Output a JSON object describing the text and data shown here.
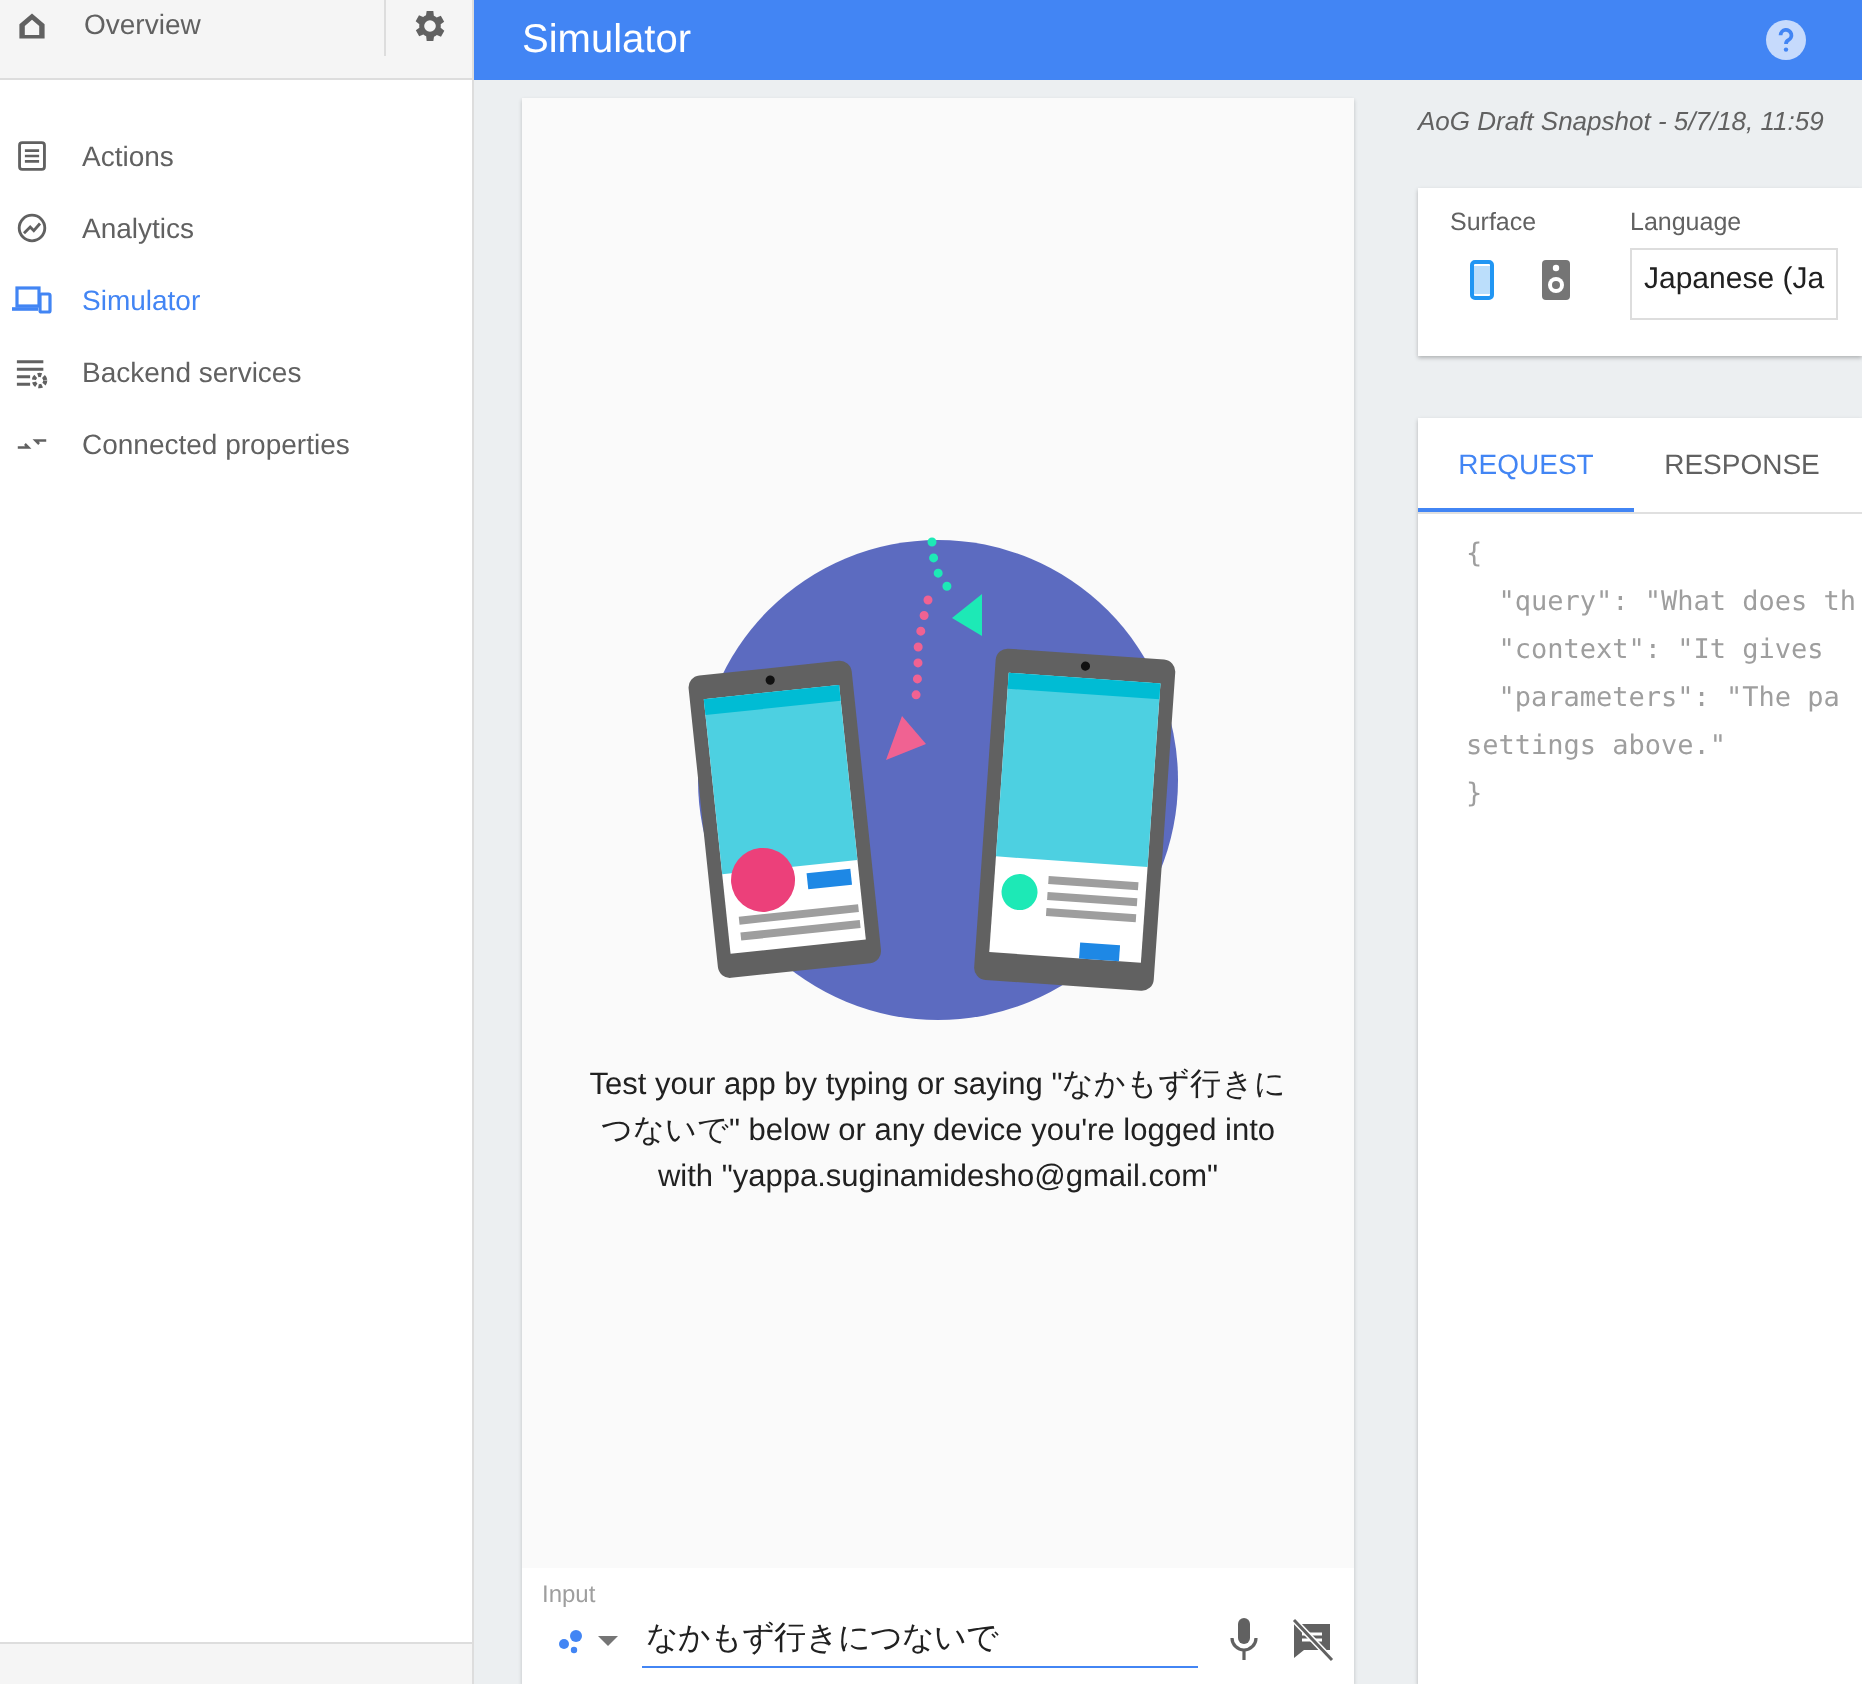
{
  "sidebar": {
    "header": {
      "label": "Overview"
    },
    "items": [
      {
        "label": "Actions",
        "kind": "list",
        "selected": false
      },
      {
        "label": "Analytics",
        "kind": "trend",
        "selected": false
      },
      {
        "label": "Simulator",
        "kind": "devices",
        "selected": true
      },
      {
        "label": "Backend services",
        "kind": "services",
        "selected": false
      },
      {
        "label": "Connected properties",
        "kind": "link",
        "selected": false
      }
    ]
  },
  "top_bar": {
    "title": "Simulator"
  },
  "simulator": {
    "message": "Test your app by typing or saying \"なかもず行きにつないで\" below or any device you're logged into with \"yappa.suginamidesho@gmail.com\"",
    "input": {
      "label": "Input",
      "value": "なかもず行きにつないで"
    }
  },
  "snapshot": "AoG Draft Snapshot - 5/7/18, 11:59",
  "settings": {
    "surface_label": "Surface",
    "surfaces": [
      {
        "kind": "phone",
        "selected": true
      },
      {
        "kind": "speaker",
        "selected": false
      }
    ],
    "language_label": "Language",
    "language": "Japanese (Ja"
  },
  "tabs": [
    {
      "label": "REQUEST",
      "selected": true
    },
    {
      "label": "RESPONSE",
      "selected": false
    }
  ],
  "code_lines": [
    "{",
    "  \"query\": \"What does th",
    "  \"context\": \"It gives",
    "  \"parameters\": \"The pa",
    "settings above.\"",
    "}"
  ]
}
